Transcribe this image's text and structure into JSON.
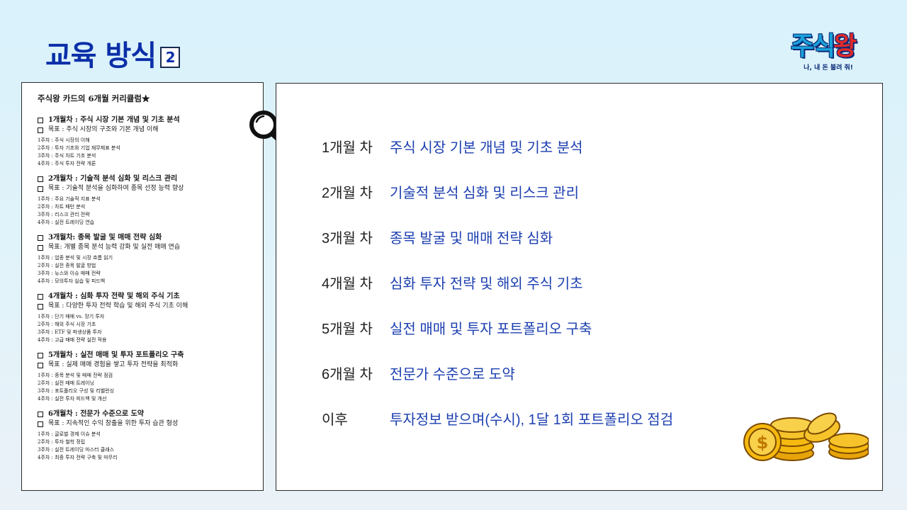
{
  "header": {
    "title": "교육 방식",
    "badge": "2"
  },
  "logo": {
    "main_blue": "주식",
    "main_red": "왕",
    "tagline": "나, 내 돈 불려 줘!"
  },
  "document": {
    "title": "주식왕 카드의 6개월 커리큘럼★",
    "sections": [
      {
        "heading": "1개월차 : 주식 시장 기본 개념 및 기초 분석",
        "goal": "목표 : 주식 시장의 구조와 기본 개념 이해",
        "weeks": [
          "1주차 : 주식 시장의 이해",
          "2주차 : 투자 기초와 기업 재무제표 분석",
          "3주차 : 주식 차트 기초 분석",
          "4주차 : 주식 투자 전략 개론"
        ]
      },
      {
        "heading": "2개월차 : 기술적 분석 심화 및 리스크 관리",
        "goal": "목표 : 기술적 분석을 심화하여 종목 선정 능력 향상",
        "weeks": [
          "1주차 : 주요 기술적 지표 분석",
          "2주차 : 차트 패턴 분석",
          "3주차 : 리스크 관리 전략",
          "4주차 : 실전 트레이딩 연습"
        ]
      },
      {
        "heading": "3개월차: 종목 발굴 및 매매 전략 심화",
        "goal": "목표: 개별 종목 분석 능력 강화 및 실전 매매 연습",
        "weeks": [
          "1주차 : 업종 분석 및 시장 흐름 읽기",
          "2주차 : 실전 종목 발굴 방법",
          "3주차 : 뉴스와 이슈 매매 전략",
          "4주차 : 모의투자 실습 및 피드백"
        ]
      },
      {
        "heading": "4개월차 : 심화 투자 전략 및 해외 주식 기초",
        "goal": "목표 : 다양한 투자 전략 학습 및 해외 주식 기초 이해",
        "weeks": [
          "1주차 : 단기 매매 vs. 장기 투자",
          "2주차 : 해외 주식 시장 기초",
          "3주차 : ETF 및 파생상품 투자",
          "4주차 : 고급 매매 전략 실전 적용"
        ]
      },
      {
        "heading": "5개월차 : 실전 매매 및 투자 포트폴리오 구축",
        "goal": "목표 : 실제 매매 경험을 쌓고 투자 전략을 최적화",
        "weeks": [
          "1주차 : 종목 분석 및 매매 전략 점검",
          "2주차 : 실전 매매 트레이닝",
          "3주차 : 포트폴리오 구성 및 리밸런싱",
          "4주차 : 실전 투자 피드백 및 개선"
        ]
      },
      {
        "heading": "6개월차 : 전문가 수준으로 도약",
        "goal": "목표 : 지속적인 수익 창출을 위한 투자 습관 형성",
        "weeks": [
          "1주차 : 글로벌 경제 이슈 분석",
          "2주차 : 투자 철학 정립",
          "3주차 : 실전 트레이딩 마스터 클래스",
          "4주차 : 최종 투자 전략 구축 및 마무리"
        ]
      }
    ]
  },
  "curriculum": [
    {
      "label": "1개월 차",
      "desc": "주식 시장 기본 개념 및 기초 분석"
    },
    {
      "label": "2개월 차",
      "desc": "기술적 분석 심화 및 리스크 관리"
    },
    {
      "label": "3개월 차",
      "desc": "종목 발굴 및 매매 전략 심화"
    },
    {
      "label": "4개월 차",
      "desc": "심화 투자 전략 및 해외 주식 기초"
    },
    {
      "label": "5개월 차",
      "desc": "실전 매매 및 투자 포트폴리오 구축"
    },
    {
      "label": "6개월 차",
      "desc": "전문가 수준으로 도약"
    },
    {
      "label": "이후",
      "desc": "투자정보 받으며(수시),  1달 1회 포트폴리오 점검"
    }
  ],
  "icons": {
    "magnifier": "magnifier-icon",
    "coins": "gold-coins-icon"
  },
  "colors": {
    "title": "#0b2fa8",
    "desc": "#1c3fb0",
    "logo_blue": "#1aa1d8",
    "logo_red": "#e02a2a",
    "coin": "#f6b90f"
  }
}
